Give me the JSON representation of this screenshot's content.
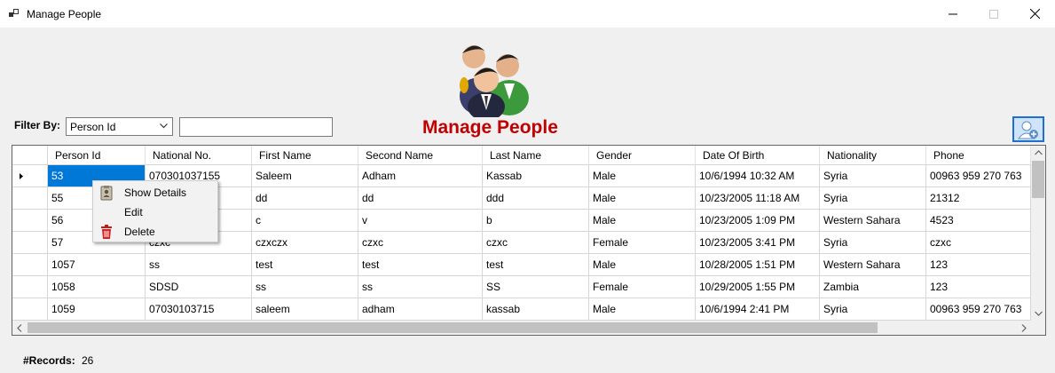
{
  "window": {
    "title": "Manage People"
  },
  "header": {
    "title": "Manage People"
  },
  "filter": {
    "label": "Filter By:",
    "selected": "Person Id",
    "text_value": ""
  },
  "table": {
    "columns": [
      "Person Id",
      "National No.",
      "First Name",
      "Second Name",
      "Last Name",
      "Gender",
      "Date Of Birth",
      "Nationality",
      "Phone"
    ],
    "rows": [
      [
        "53",
        "070301037155",
        "Saleem",
        "Adham",
        "Kassab",
        "Male",
        "10/6/1994 10:32 AM",
        "Syria",
        "00963 959 270 763"
      ],
      [
        "55",
        "",
        "dd",
        "dd",
        "ddd",
        "Male",
        "10/23/2005 11:18 AM",
        "Syria",
        "21312"
      ],
      [
        "56",
        "",
        "c",
        "v",
        "b",
        "Male",
        "10/23/2005 1:09 PM",
        "Western Sahara",
        "4523"
      ],
      [
        "57",
        "czxc",
        "czxczx",
        "czxc",
        "czxc",
        "Female",
        "10/23/2005 3:41 PM",
        "Syria",
        "czxc"
      ],
      [
        "1057",
        "ss",
        "test",
        "test",
        "test",
        "Male",
        "10/28/2005 1:51 PM",
        "Western Sahara",
        "123"
      ],
      [
        "1058",
        "SDSD",
        "ss",
        "ss",
        "SS",
        "Female",
        "10/29/2005 1:55 PM",
        "Zambia",
        "123"
      ],
      [
        "1059",
        "07030103715",
        "saleem",
        "adham",
        "kassab",
        "Male",
        "10/6/1994 2:41 PM",
        "Syria",
        "00963 959 270 763"
      ]
    ]
  },
  "context_menu": {
    "items": [
      {
        "label": "Show Details",
        "icon": "details-icon"
      },
      {
        "label": "Edit",
        "icon": ""
      },
      {
        "label": "Delete",
        "icon": "trash-icon"
      }
    ]
  },
  "footer": {
    "records_label": "#Records:",
    "records_count": "26"
  },
  "colors": {
    "heading": "#c00000",
    "selection": "#0078d7",
    "add_button_border": "#1e6fd0"
  }
}
